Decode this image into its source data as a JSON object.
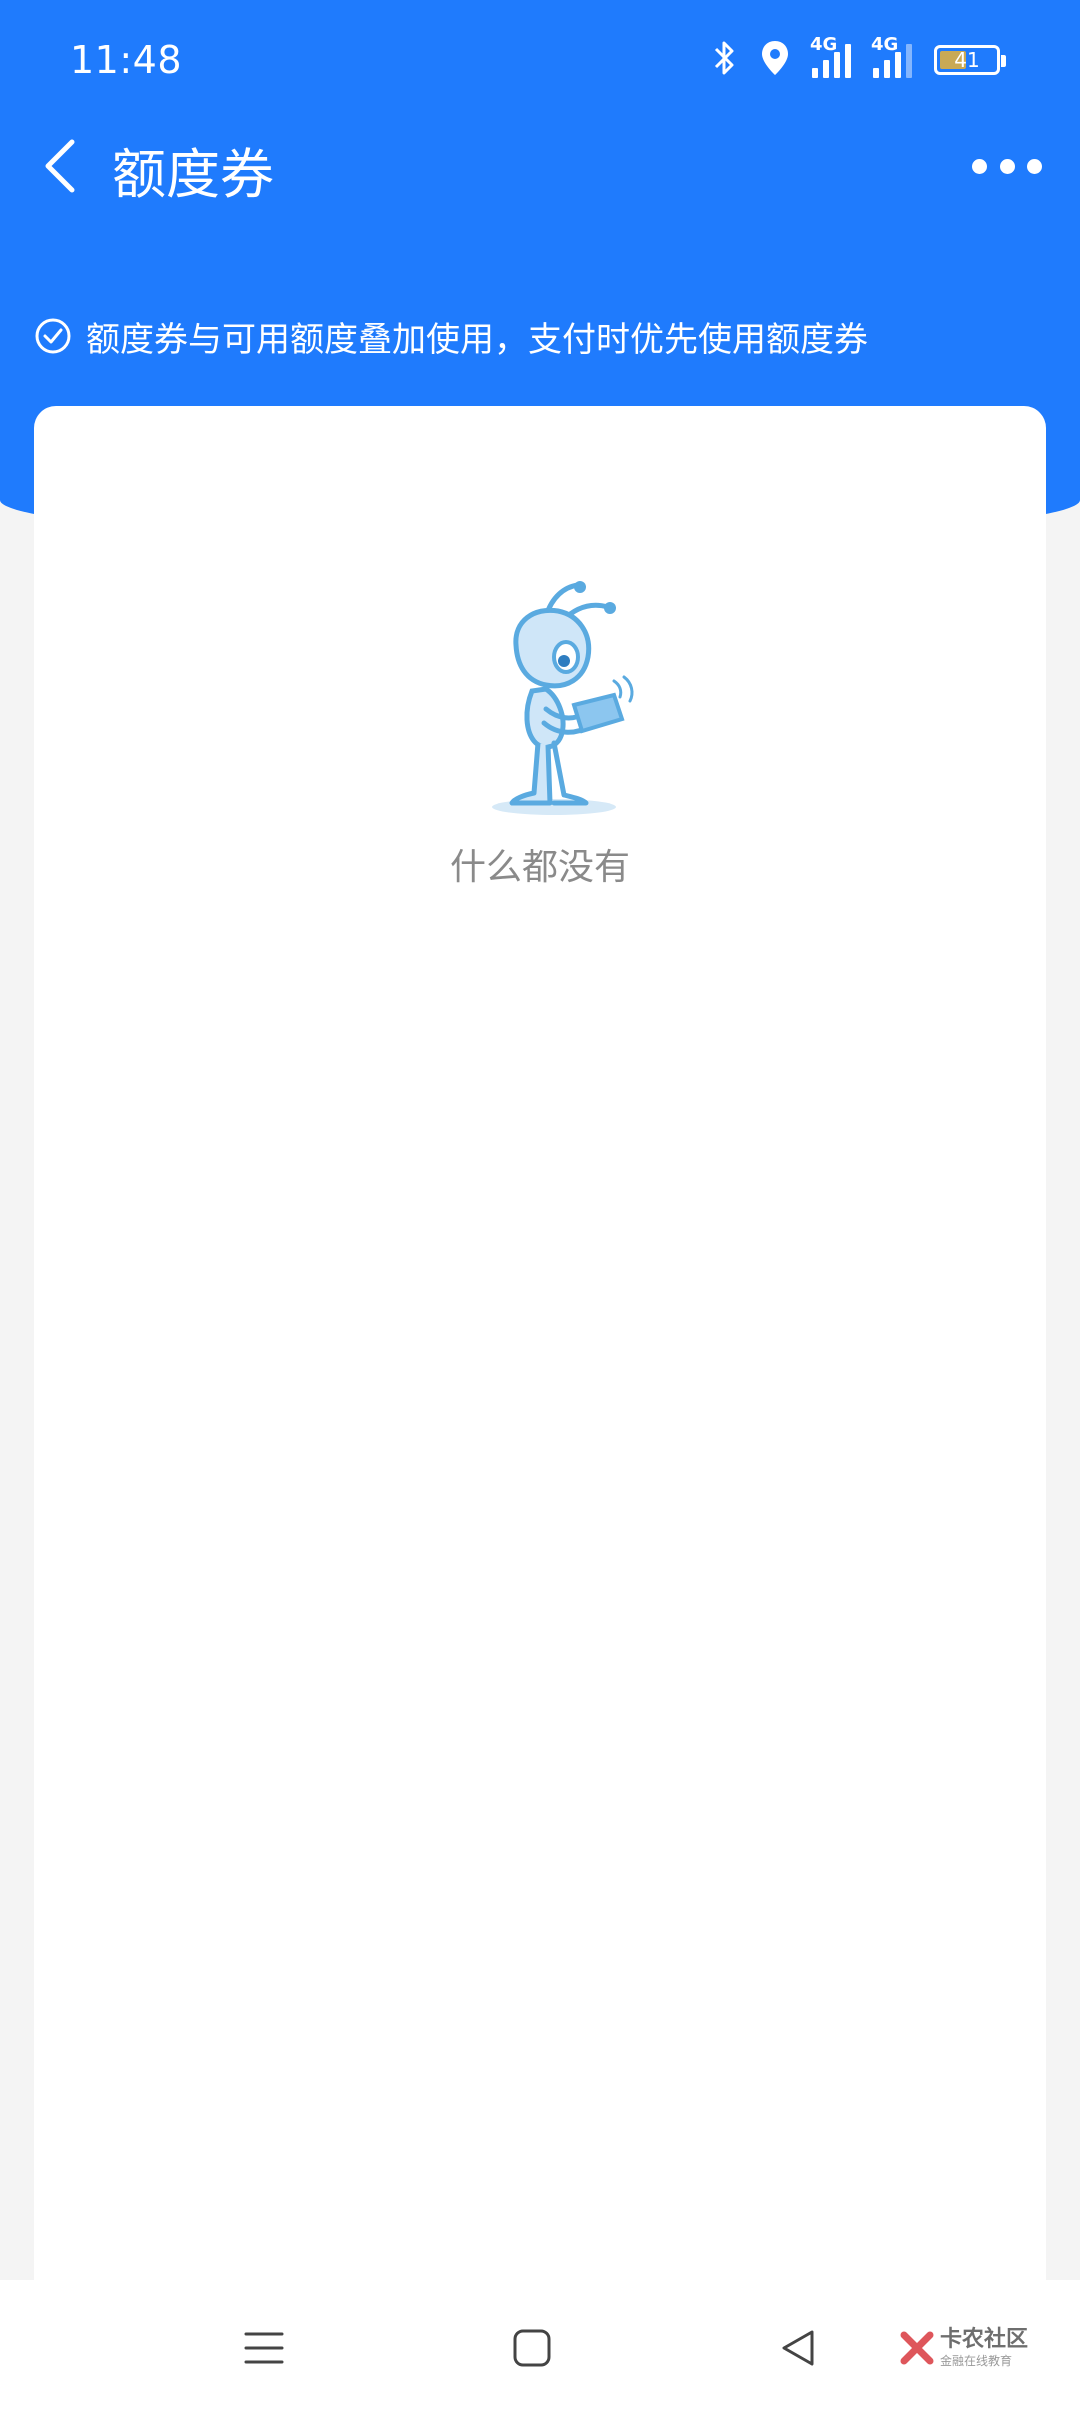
{
  "status_bar": {
    "time": "11:48",
    "network_1": "4G",
    "network_2": "4G",
    "battery_level": "41"
  },
  "nav": {
    "title": "额度券"
  },
  "info": {
    "text": "额度券与可用额度叠加使用，支付时优先使用额度券"
  },
  "empty_state": {
    "text": "什么都没有"
  },
  "watermark": {
    "main": "卡农社区",
    "sub": "金融在线教育"
  },
  "colors": {
    "primary_blue": "#1f7bfd",
    "page_bg": "#f4f4f4",
    "empty_text": "#8a8a8a"
  }
}
